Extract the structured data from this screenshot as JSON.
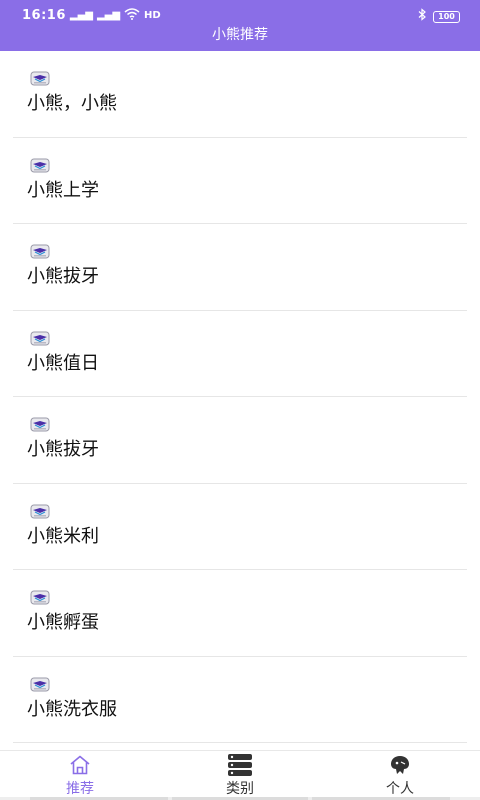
{
  "status_bar": {
    "time": "16:16",
    "signal_1": "4G",
    "signal_2": "4G",
    "network": "HD",
    "battery": "100"
  },
  "header": {
    "title": "小熊推荐"
  },
  "list": {
    "items": [
      {
        "title": "小熊，小熊"
      },
      {
        "title": "小熊上学"
      },
      {
        "title": "小熊拔牙"
      },
      {
        "title": "小熊值日"
      },
      {
        "title": "小熊拔牙"
      },
      {
        "title": "小熊米利"
      },
      {
        "title": "小熊孵蛋"
      },
      {
        "title": "小熊洗衣服"
      }
    ]
  },
  "tabbar": {
    "tabs": [
      {
        "label": "推荐",
        "icon": "home-icon",
        "active": true
      },
      {
        "label": "类别",
        "icon": "category-icon",
        "active": false
      },
      {
        "label": "个人",
        "icon": "profile-icon",
        "active": false
      }
    ]
  },
  "colors": {
    "accent": "#8a6ee7",
    "header_bg": "#8a6ee7",
    "divider": "#e6e6e6"
  }
}
